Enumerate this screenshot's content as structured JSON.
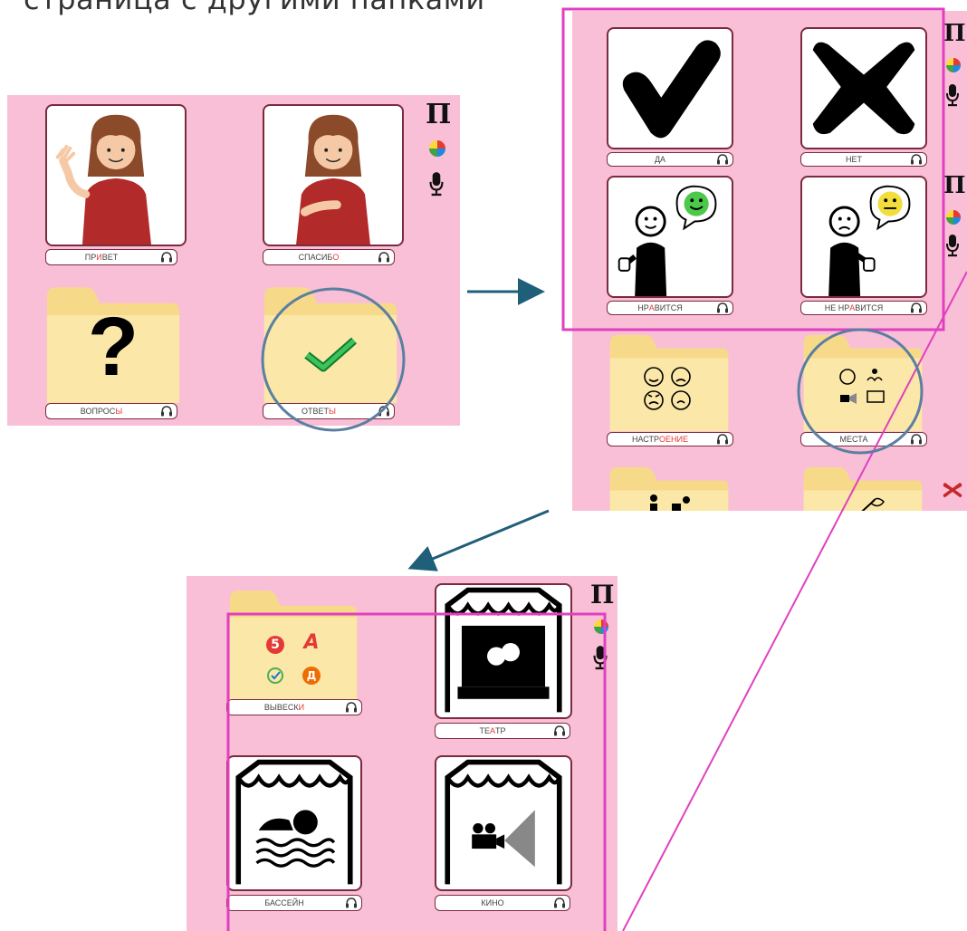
{
  "heading": "страница с другими папками",
  "side_controls": {
    "symbol": "П"
  },
  "screen1": {
    "cards": [
      {
        "label_parts": [
          "ПР",
          "И",
          "ВЕТ"
        ]
      },
      {
        "label_parts": [
          "СПАСИБ",
          "О",
          ""
        ]
      }
    ],
    "folders": [
      {
        "label_parts": [
          "ВОПРОС",
          "Ы",
          ""
        ],
        "symbol": "?"
      },
      {
        "label_parts": [
          "ОТВЕТ",
          "Ы",
          ""
        ]
      }
    ]
  },
  "screen2": {
    "cards": [
      {
        "label_parts": [
          "ДА",
          "",
          ""
        ]
      },
      {
        "label_parts": [
          "НЕТ",
          "",
          ""
        ]
      },
      {
        "label_parts": [
          "НР",
          "А",
          "ВИТСЯ"
        ]
      },
      {
        "label_parts": [
          "НЕ НР",
          "А",
          "ВИТСЯ"
        ]
      }
    ],
    "folders": [
      {
        "label_parts": [
          "НАСТР",
          "ОЕНИЕ",
          ""
        ]
      },
      {
        "label_parts": [
          "МЕСТА",
          "",
          ""
        ]
      }
    ]
  },
  "screen3": {
    "folder": {
      "label_parts": [
        "ВЫВЕСК",
        "И",
        ""
      ],
      "logos": [
        "5",
        "A",
        "",
        "Д"
      ]
    },
    "cards": [
      {
        "label_parts": [
          "ТЕ",
          "А",
          "ТР"
        ]
      },
      {
        "label_parts": [
          "БАССЕЙН",
          "",
          ""
        ]
      },
      {
        "label_parts": [
          "КИНО",
          "",
          ""
        ]
      }
    ]
  },
  "colors": {
    "panel": "#f9bfd6",
    "frame": "#7a2b3d",
    "highlight": "#e040c0",
    "circle": "#5a7fa0",
    "arrow": "#1f5f7a",
    "label_accent": "#e53935"
  }
}
